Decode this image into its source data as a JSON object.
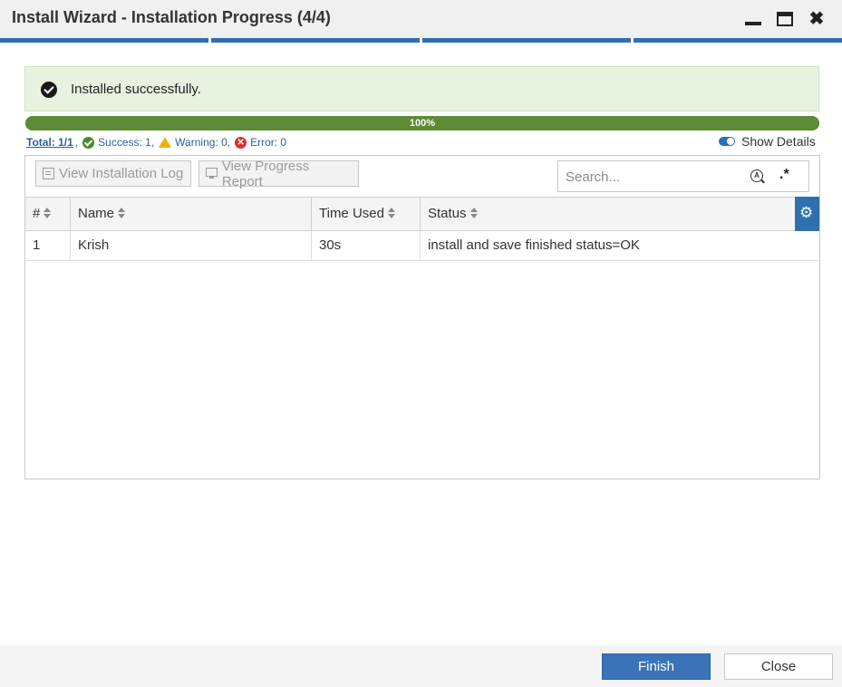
{
  "window": {
    "title": "Install Wizard - Installation Progress (4/4)",
    "controls": [
      "minimize-icon",
      "maximize-icon",
      "close-icon"
    ],
    "close_glyph": "✖"
  },
  "steps": {
    "total": 4,
    "current": 4
  },
  "banner": {
    "message": "Installed successfully.",
    "icon": "check-circle-icon",
    "bg_color": "#e8f3df"
  },
  "progress": {
    "percent": 100,
    "label": "100%",
    "color": "#5d8a34"
  },
  "stats": {
    "total_label": "Total: 1/1",
    "sep": ",",
    "success_label": "Success: 1,",
    "warning_label": "Warning: 0,",
    "error_label": "Error: 0",
    "error_glyph": "✕"
  },
  "show_details": {
    "label": "Show Details",
    "enabled": true
  },
  "toolbar": {
    "view_log_label": "View Installation Log",
    "view_report_label": "View Progress Report",
    "enabled": false
  },
  "search": {
    "placeholder": "Search...",
    "value": "",
    "case_icon_glyph": "A",
    "regex_glyph": ".*"
  },
  "table": {
    "columns": [
      "#",
      "Name",
      "Time Used",
      "Status"
    ],
    "settings_glyph": "⚙",
    "rows": [
      {
        "num": "1",
        "name": "Krish",
        "time": "30s",
        "status": "install and save finished status=OK"
      }
    ]
  },
  "footer": {
    "finish_label": "Finish",
    "close_label": "Close"
  },
  "colors": {
    "accent": "#2f6fb0",
    "success": "#4a8a2a",
    "warning": "#f0b400",
    "error": "#d93030"
  }
}
